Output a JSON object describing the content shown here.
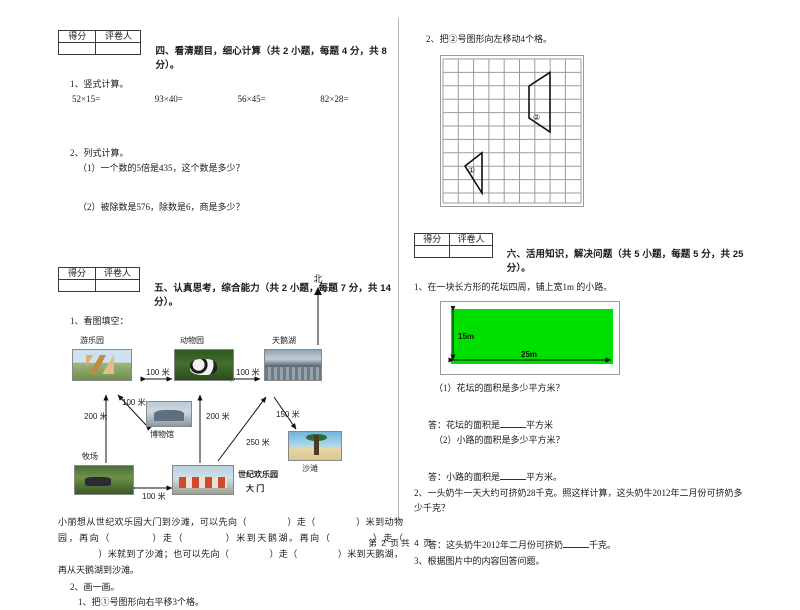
{
  "document": {
    "footer": "第 2 页 共 4 页",
    "footer_parts": {
      "prefix": "第",
      "page": "2",
      "middle": "页 共",
      "total": "4",
      "suffix": "页"
    }
  },
  "score_table": {
    "score_label": "得分",
    "grader_label": "评卷人"
  },
  "section_four": {
    "heading": "四、看清题目，细心计算（共 2 小题，每题 4 分，共 8 分）。",
    "q1_title": "1、竖式计算。",
    "q1_problems": [
      "52×15=",
      "93×40=",
      "56×45=",
      "82×28="
    ],
    "q2_title": "2、列式计算。",
    "q2_items": [
      "（1）一个数的5倍是435，这个数是多少？",
      "（2）被除数是576，除数是6，商是多少？"
    ]
  },
  "section_five": {
    "heading": "五、认真思考，综合能力（共 2 小题，每题 7 分，共 14 分）。",
    "q1_title": "1、看图填空：",
    "compass": "北",
    "map": {
      "places": [
        {
          "name": "游乐园",
          "icon": "amusement-park-photo"
        },
        {
          "name": "动物园",
          "icon": "zoo-photo"
        },
        {
          "name": "天鹅湖",
          "icon": "swan-lake-photo"
        },
        {
          "name": "沙滩",
          "icon": "beach-photo"
        },
        {
          "name": "牧场",
          "icon": "pasture-photo"
        },
        {
          "name": "博物馆",
          "icon": "museum-photo"
        },
        {
          "name": "世纪欢乐园\n大  门",
          "icon": "gate-photo"
        }
      ],
      "distances": [
        "100 米",
        "100 米",
        "100 米",
        "150 米",
        "200 米",
        "200 米",
        "250 米",
        "100 米"
      ],
      "gate_label_line1": "世纪欢乐园",
      "gate_label_line2": "大  门"
    },
    "fill_text_1": "小丽想从世纪欢乐园大门到沙滩，可以先向（",
    "fill_text_2": "）走（",
    "fill_text_3": "）米到动物园，再向（",
    "fill_text_4": "）走（",
    "fill_text_5": "）米到天鹅湖。再向（",
    "fill_text_6": "）走（",
    "fill_text_7": "）米就到了沙滩；也可以先向（",
    "fill_text_8": "）走（",
    "fill_text_9": "）米到天鹅湖，再从天鹅湖到沙滩。",
    "q2_title": "2、画一画。",
    "q2_item1": "1、把①号图形向右平移3个格。",
    "q2_item2": "2、把②号图形向左移动4个格。",
    "shape1_label": "①",
    "shape2_label": "②"
  },
  "section_six": {
    "heading": "六、活用知识，解决问题（共 5 小题，每题 5 分，共 25 分）。",
    "q1_title": "1、在一块长方形的花坛四周，铺上宽1m 的小路。",
    "figure": {
      "height_label": "15m",
      "width_label": "25m",
      "fill_color": "#00e000"
    },
    "q1a": "（1）花坛的面积是多少平方米？",
    "q1a_answer_prefix": "答：花坛的面积是",
    "q1a_answer_suffix": "平方米",
    "q1b": "（2）小路的面积是多少平方米？",
    "q1b_answer_prefix": "答：小路的面积是",
    "q1b_answer_suffix": "平方米。",
    "q2": "2、一头奶牛一天大约可挤奶28千克。照这样计算，这头奶牛2012年二月份可挤奶多少千克？",
    "q2_answer_prefix": "答：这头奶牛2012年二月份可挤奶",
    "q2_answer_suffix": "千克。",
    "q3": "3、根据图片中的内容回答问题。"
  }
}
